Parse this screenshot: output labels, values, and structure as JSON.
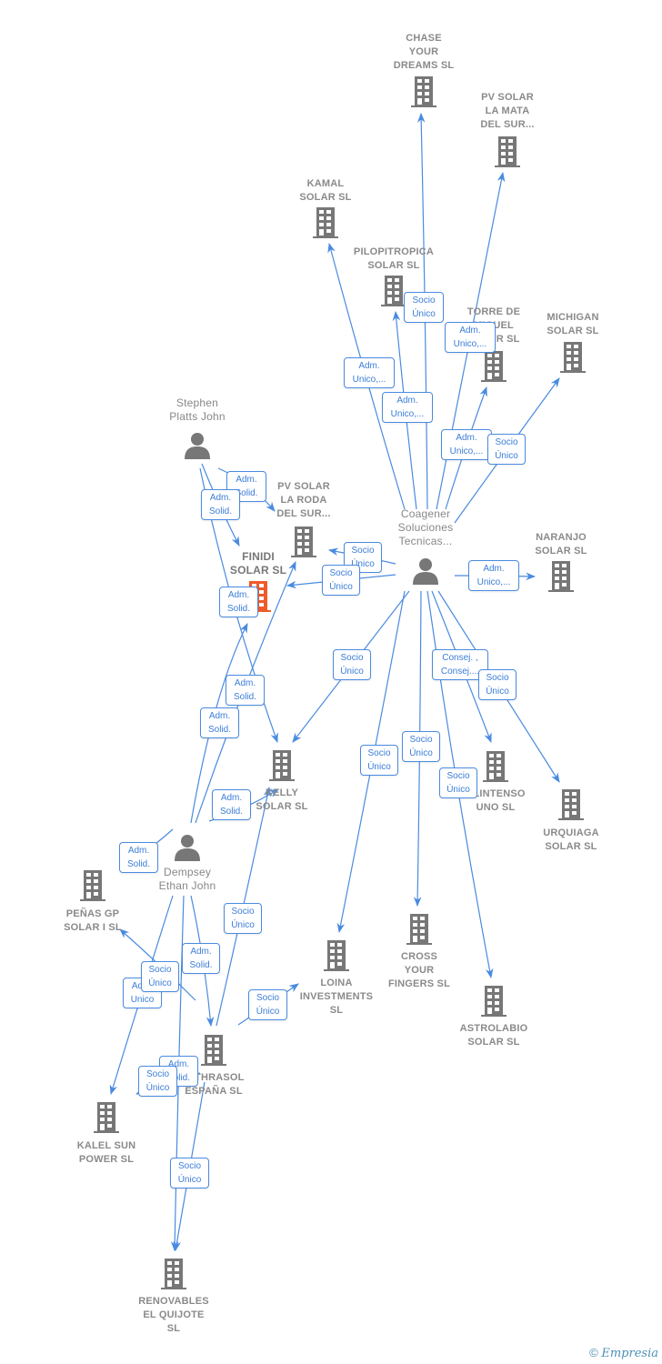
{
  "colors": {
    "edge": "#4a8be0",
    "icon": "#777777",
    "main_company": "#f05a28",
    "label": "#8a8a8a"
  },
  "nodes": [
    {
      "label": "CHASE\nYOUR\nDREAMS  SL",
      "type": "company"
    },
    {
      "label": "PV SOLAR\nLA MATA\nDEL SUR...",
      "type": "company"
    },
    {
      "label": "KAMAL\nSOLAR  SL",
      "type": "company"
    },
    {
      "label": "PILOPITROPICA\nSOLAR  SL",
      "type": "company"
    },
    {
      "label": "TORRE DE\nMIGUEL\nSOLAR SL",
      "type": "company"
    },
    {
      "label": "MICHIGAN\nSOLAR  SL",
      "type": "company"
    },
    {
      "label": "Coagener\nSoluciones\nTecnicas...",
      "type": "person"
    },
    {
      "label": "NARANJO\nSOLAR  SL",
      "type": "company"
    },
    {
      "label": "Stephen\nPlatts John",
      "type": "person"
    },
    {
      "label": "PV SOLAR\nLA RODA\nDEL SUR...",
      "type": "company"
    },
    {
      "label": "FINIDI\nSOLAR  SL",
      "type": "main-company"
    },
    {
      "label": "KELLY\nSOLAR  SL",
      "type": "company"
    },
    {
      "label": "CLINTENSO\nUNO  SL",
      "type": "company"
    },
    {
      "label": "URQUIAGA\nSOLAR  SL",
      "type": "company"
    },
    {
      "label": "Dempsey\nEthan John",
      "type": "person"
    },
    {
      "label": "PEÑAS GP\nSOLAR I  SL",
      "type": "company"
    },
    {
      "label": "LOINA\nINVESTMENTS\nSL",
      "type": "company"
    },
    {
      "label": "CROSS\nYOUR\nFINGERS  SL",
      "type": "company"
    },
    {
      "label": "ASTROLABIO\nSOLAR  SL",
      "type": "company"
    },
    {
      "label": "MITHRASOL\nESPAÑA  SL",
      "type": "company"
    },
    {
      "label": "KALEL SUN\nPOWER  SL",
      "type": "company"
    },
    {
      "label": "RENOVABLES\nEL QUIJOTE\nSL",
      "type": "company"
    }
  ],
  "edges": [
    {
      "from": "Coagener Soluciones Tecnicas...",
      "to": "CHASE YOUR DREAMS SL",
      "label": "Socio\nÚnico"
    },
    {
      "from": "Coagener Soluciones Tecnicas...",
      "to": "PV SOLAR LA MATA DEL SUR...",
      "label": "Adm.\nUnico,..."
    },
    {
      "from": "Coagener Soluciones Tecnicas...",
      "to": "KAMAL SOLAR SL",
      "label": "Adm.\nUnico,..."
    },
    {
      "from": "Coagener Soluciones Tecnicas...",
      "to": "PILOPITROPICA SOLAR SL",
      "label": "Adm.\nUnico,..."
    },
    {
      "from": "Coagener Soluciones Tecnicas...",
      "to": "TORRE DE MIGUEL SOLAR SL",
      "label": "Adm.\nUnico,..."
    },
    {
      "from": "Coagener Soluciones Tecnicas...",
      "to": "MICHIGAN SOLAR SL",
      "label": "Socio\nÚnico"
    },
    {
      "from": "Coagener Soluciones Tecnicas...",
      "to": "PV SOLAR LA RODA DEL SUR...",
      "label": "Socio\nÚnico"
    },
    {
      "from": "Coagener Soluciones Tecnicas...",
      "to": "FINIDI SOLAR SL",
      "label": "Socio\nÚnico"
    },
    {
      "from": "Coagener Soluciones Tecnicas...",
      "to": "NARANJO SOLAR SL",
      "label": "Adm.\nUnico,..."
    },
    {
      "from": "Coagener Soluciones Tecnicas...",
      "to": "KELLY SOLAR SL",
      "label": "Socio\nÚnico"
    },
    {
      "from": "Coagener Soluciones Tecnicas...",
      "to": "LOINA INVESTMENTS SL",
      "label": "Socio\nÚnico"
    },
    {
      "from": "Coagener Soluciones Tecnicas...",
      "to": "CROSS YOUR FINGERS SL",
      "label": "Socio\nÚnico"
    },
    {
      "from": "Coagener Soluciones Tecnicas...",
      "to": "ASTROLABIO SOLAR SL",
      "label": "Socio\nÚnico"
    },
    {
      "from": "Coagener Soluciones Tecnicas...",
      "to": "CLINTENSO UNO SL",
      "label": "Consej. ,\nConsej...."
    },
    {
      "from": "Coagener Soluciones Tecnicas...",
      "to": "URQUIAGA SOLAR SL",
      "label": "Socio\nÚnico"
    },
    {
      "from": "Stephen Platts John",
      "to": "PV SOLAR LA RODA DEL SUR...",
      "label": "Adm.\nSolid."
    },
    {
      "from": "Stephen Platts John",
      "to": "FINIDI SOLAR SL",
      "label": "Adm.\nSolid."
    },
    {
      "from": "Stephen Platts John",
      "to": "KELLY SOLAR SL",
      "label": "Adm.\nSolid."
    },
    {
      "from": "Dempsey Ethan John",
      "to": "FINIDI SOLAR SL",
      "label": "Adm.\nSolid."
    },
    {
      "from": "Dempsey Ethan John",
      "to": "PV SOLAR LA RODA DEL SUR...",
      "label": "Adm.\nSolid."
    },
    {
      "from": "Dempsey Ethan John",
      "to": "KELLY SOLAR SL",
      "label": "Adm.\nSolid."
    },
    {
      "from": "Dempsey Ethan John",
      "to": "PEÑAS GP SOLAR I SL",
      "label": "Adm.\nSolid."
    },
    {
      "from": "Dempsey Ethan John",
      "to": "MITHRASOL ESPAÑA SL",
      "label": "Adm.\nSolid."
    },
    {
      "from": "Dempsey Ethan John",
      "to": "KALEL SUN POWER SL",
      "label": "Adm.\nUnico"
    },
    {
      "from": "Dempsey Ethan John",
      "to": "RENOVABLES EL QUIJOTE SL",
      "label": "Adm.\nSolid."
    },
    {
      "from": "MITHRASOL ESPAÑA SL",
      "to": "PEÑAS GP SOLAR I SL",
      "label": "Socio\nÚnico"
    },
    {
      "from": "MITHRASOL ESPAÑA SL",
      "to": "KELLY SOLAR SL",
      "label": "Socio\nÚnico"
    },
    {
      "from": "MITHRASOL ESPAÑA SL",
      "to": "LOINA INVESTMENTS SL",
      "label": "Socio\nÚnico"
    },
    {
      "from": "MITHRASOL ESPAÑA SL",
      "to": "KALEL SUN POWER SL",
      "label": "Socio\nÚnico"
    },
    {
      "from": "MITHRASOL ESPAÑA SL",
      "to": "RENOVABLES EL QUIJOTE SL",
      "label": "Socio\nÚnico"
    }
  ],
  "footer": {
    "copyright": "©",
    "brand": "Empresia"
  }
}
